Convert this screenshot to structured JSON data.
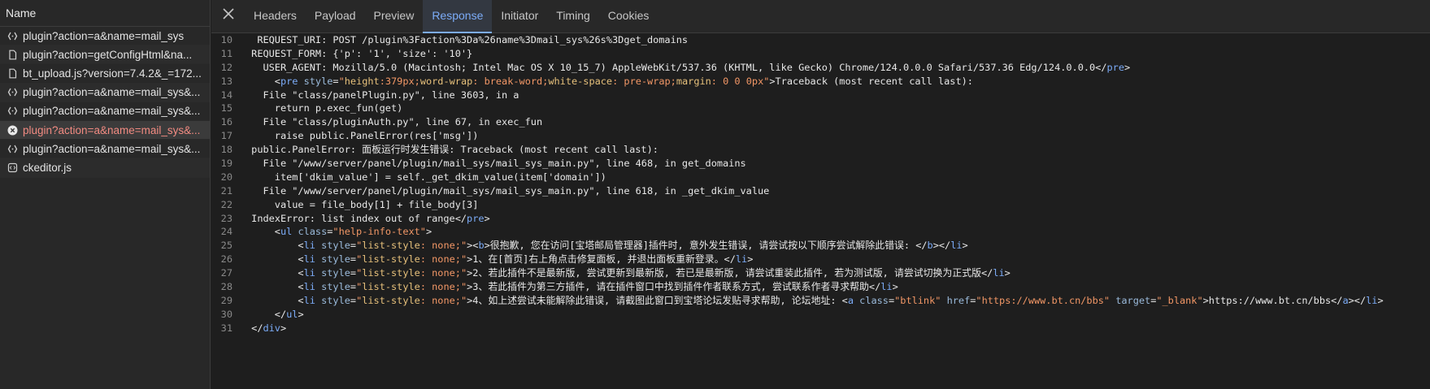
{
  "network": {
    "name_header": "Name",
    "requests": [
      {
        "name": "plugin?action=a&name=mail_sys",
        "icon": "xhr-icon",
        "status": "normal"
      },
      {
        "name": "plugin?action=getConfigHtml&na...",
        "icon": "document-icon",
        "status": "normal"
      },
      {
        "name": "bt_upload.js?version=7.4.2&_=172...",
        "icon": "document-icon",
        "status": "normal"
      },
      {
        "name": "plugin?action=a&name=mail_sys&...",
        "icon": "xhr-icon",
        "status": "normal"
      },
      {
        "name": "plugin?action=a&name=mail_sys&...",
        "icon": "xhr-icon",
        "status": "normal"
      },
      {
        "name": "plugin?action=a&name=mail_sys&...",
        "icon": "error-icon",
        "status": "error"
      },
      {
        "name": "plugin?action=a&name=mail_sys&...",
        "icon": "xhr-icon",
        "status": "normal"
      },
      {
        "name": "ckeditor.js",
        "icon": "script-icon",
        "status": "normal"
      }
    ]
  },
  "tabs": [
    {
      "label": "Headers",
      "active": false
    },
    {
      "label": "Payload",
      "active": false
    },
    {
      "label": "Preview",
      "active": false
    },
    {
      "label": "Response",
      "active": true
    },
    {
      "label": "Initiator",
      "active": false
    },
    {
      "label": "Timing",
      "active": false
    },
    {
      "label": "Cookies",
      "active": false
    }
  ],
  "response": {
    "lines": [
      {
        "n": "10",
        "segs": [
          [
            "t",
            "  REQUEST_URI: POST /plugin%3Faction%3Da%26name%3Dmail_sys%26s%3Dget_domains"
          ]
        ]
      },
      {
        "n": "11",
        "segs": [
          [
            "t",
            " REQUEST_FORM: {'p': '1', 'size': '10'}"
          ]
        ]
      },
      {
        "n": "12",
        "segs": [
          [
            "t",
            "   USER_AGENT: Mozilla/5.0 (Macintosh; Intel Mac OS X 10_15_7) AppleWebKit/537.36 (KHTML, like Gecko) Chrome/124.0.0.0 Safari/537.36 Edg/124.0.0.0</"
          ],
          [
            "tag",
            "pre"
          ],
          [
            "t",
            ">"
          ]
        ]
      },
      {
        "n": "13",
        "segs": [
          [
            "t",
            "     <"
          ],
          [
            "tag",
            "pre"
          ],
          [
            "t",
            " "
          ],
          [
            "attr",
            "style"
          ],
          [
            "t",
            "="
          ],
          [
            "val",
            "\""
          ],
          [
            "prop",
            "height"
          ],
          [
            "val",
            ":379px;"
          ],
          [
            "prop",
            "word-wrap"
          ],
          [
            "val",
            ": break-word;"
          ],
          [
            "prop",
            "white-space"
          ],
          [
            "val",
            ": pre-wrap;"
          ],
          [
            "prop",
            "margin"
          ],
          [
            "val",
            ": 0 0 0px\""
          ],
          [
            "t",
            ">Traceback (most recent call last):"
          ]
        ]
      },
      {
        "n": "14",
        "segs": [
          [
            "t",
            "   File \"class/panelPlugin.py\", line 3603, in a"
          ]
        ]
      },
      {
        "n": "15",
        "segs": [
          [
            "t",
            "     return p.exec_fun(get)"
          ]
        ]
      },
      {
        "n": "16",
        "segs": [
          [
            "t",
            "   File \"class/pluginAuth.py\", line 67, in exec_fun"
          ]
        ]
      },
      {
        "n": "17",
        "segs": [
          [
            "t",
            "     raise public.PanelError(res['msg'])"
          ]
        ]
      },
      {
        "n": "18",
        "segs": [
          [
            "t",
            " public.PanelError: 面板运行时发生错误: Traceback (most recent call last):"
          ]
        ]
      },
      {
        "n": "19",
        "segs": [
          [
            "t",
            "   File \"/www/server/panel/plugin/mail_sys/mail_sys_main.py\", line 468, in get_domains"
          ]
        ]
      },
      {
        "n": "20",
        "segs": [
          [
            "t",
            "     item['dkim_value'] = self._get_dkim_value(item['domain'])"
          ]
        ]
      },
      {
        "n": "21",
        "segs": [
          [
            "t",
            "   File \"/www/server/panel/plugin/mail_sys/mail_sys_main.py\", line 618, in _get_dkim_value"
          ]
        ]
      },
      {
        "n": "22",
        "segs": [
          [
            "t",
            "     value = file_body[1] + file_body[3]"
          ]
        ]
      },
      {
        "n": "23",
        "segs": [
          [
            "t",
            " IndexError: list index out of range</"
          ],
          [
            "tag",
            "pre"
          ],
          [
            "t",
            ">"
          ]
        ]
      },
      {
        "n": "24",
        "segs": [
          [
            "t",
            "     <"
          ],
          [
            "tag",
            "ul"
          ],
          [
            "t",
            " "
          ],
          [
            "attr",
            "class"
          ],
          [
            "t",
            "="
          ],
          [
            "val",
            "\"help-info-text\""
          ],
          [
            "t",
            ">"
          ]
        ]
      },
      {
        "n": "25",
        "segs": [
          [
            "t",
            "         <"
          ],
          [
            "tag",
            "li"
          ],
          [
            "t",
            " "
          ],
          [
            "attr",
            "style"
          ],
          [
            "t",
            "="
          ],
          [
            "val",
            "\""
          ],
          [
            "prop",
            "list-style"
          ],
          [
            "val",
            ": none;\""
          ],
          [
            "t",
            "><"
          ],
          [
            "tag",
            "b"
          ],
          [
            "t",
            ">很抱歉, 您在访问[宝塔邮局管理器]插件时, 意外发生错误, 请尝试按以下顺序尝试解除此错误: </"
          ],
          [
            "tag",
            "b"
          ],
          [
            "t",
            "></"
          ],
          [
            "tag",
            "li"
          ],
          [
            "t",
            ">"
          ]
        ]
      },
      {
        "n": "26",
        "segs": [
          [
            "t",
            "         <"
          ],
          [
            "tag",
            "li"
          ],
          [
            "t",
            " "
          ],
          [
            "attr",
            "style"
          ],
          [
            "t",
            "="
          ],
          [
            "val",
            "\""
          ],
          [
            "prop",
            "list-style"
          ],
          [
            "val",
            ": none;\""
          ],
          [
            "t",
            ">1、在[首页]右上角点击修复面板, 并退出面板重新登录。</"
          ],
          [
            "tag",
            "li"
          ],
          [
            "t",
            ">"
          ]
        ]
      },
      {
        "n": "27",
        "segs": [
          [
            "t",
            "         <"
          ],
          [
            "tag",
            "li"
          ],
          [
            "t",
            " "
          ],
          [
            "attr",
            "style"
          ],
          [
            "t",
            "="
          ],
          [
            "val",
            "\""
          ],
          [
            "prop",
            "list-style"
          ],
          [
            "val",
            ": none;\""
          ],
          [
            "t",
            ">2、若此插件不是最新版, 尝试更新到最新版, 若已是最新版, 请尝试重装此插件, 若为测试版, 请尝试切换为正式版</"
          ],
          [
            "tag",
            "li"
          ],
          [
            "t",
            ">"
          ]
        ]
      },
      {
        "n": "28",
        "segs": [
          [
            "t",
            "         <"
          ],
          [
            "tag",
            "li"
          ],
          [
            "t",
            " "
          ],
          [
            "attr",
            "style"
          ],
          [
            "t",
            "="
          ],
          [
            "val",
            "\""
          ],
          [
            "prop",
            "list-style"
          ],
          [
            "val",
            ": none;\""
          ],
          [
            "t",
            ">3、若此插件为第三方插件, 请在插件窗口中找到插件作者联系方式, 尝试联系作者寻求帮助</"
          ],
          [
            "tag",
            "li"
          ],
          [
            "t",
            ">"
          ]
        ]
      },
      {
        "n": "29",
        "segs": [
          [
            "t",
            "         <"
          ],
          [
            "tag",
            "li"
          ],
          [
            "t",
            " "
          ],
          [
            "attr",
            "style"
          ],
          [
            "t",
            "="
          ],
          [
            "val",
            "\""
          ],
          [
            "prop",
            "list-style"
          ],
          [
            "val",
            ": none;\""
          ],
          [
            "t",
            ">4、如上述尝试未能解除此错误, 请截图此窗口到宝塔论坛发贴寻求帮助, 论坛地址: <"
          ],
          [
            "tag",
            "a"
          ],
          [
            "t",
            " "
          ],
          [
            "attr",
            "class"
          ],
          [
            "t",
            "="
          ],
          [
            "val",
            "\"btlink\""
          ],
          [
            "t",
            " "
          ],
          [
            "attr",
            "href"
          ],
          [
            "t",
            "="
          ],
          [
            "val",
            "\"https://www.bt.cn/bbs\""
          ],
          [
            "t",
            " "
          ],
          [
            "attr",
            "target"
          ],
          [
            "t",
            "="
          ],
          [
            "val",
            "\"_blank\""
          ],
          [
            "t",
            ">https://www.bt.cn/bbs</"
          ],
          [
            "tag",
            "a"
          ],
          [
            "t",
            "></"
          ],
          [
            "tag",
            "li"
          ],
          [
            "t",
            ">"
          ]
        ]
      },
      {
        "n": "30",
        "segs": [
          [
            "t",
            "     </"
          ],
          [
            "tag",
            "ul"
          ],
          [
            "t",
            ">"
          ]
        ]
      },
      {
        "n": "31",
        "segs": [
          [
            "t",
            " </"
          ],
          [
            "tag",
            "div"
          ],
          [
            "t",
            ">"
          ]
        ]
      }
    ]
  }
}
